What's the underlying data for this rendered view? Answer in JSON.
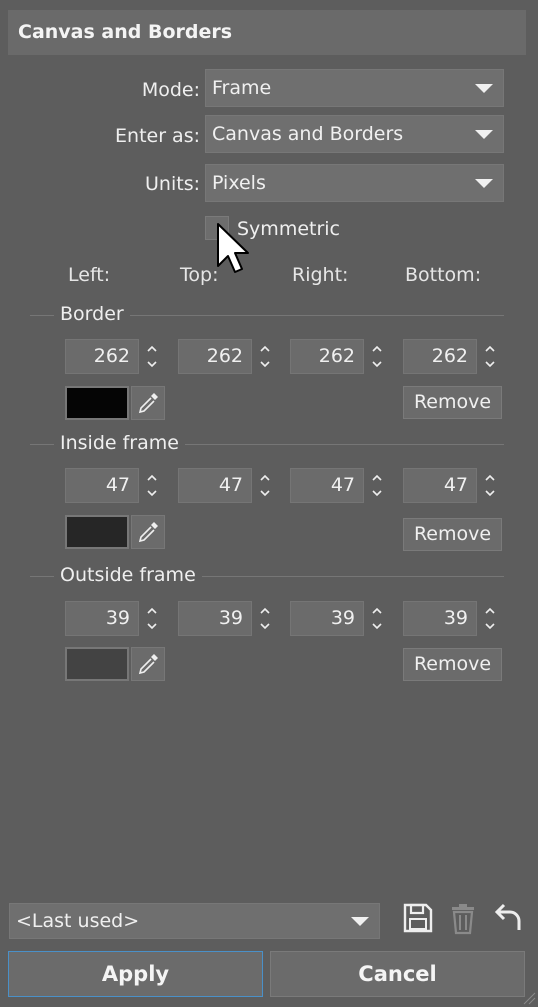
{
  "title": "Canvas and Borders",
  "mode": {
    "label": "Mode:",
    "value": "Frame"
  },
  "enter_as": {
    "label": "Enter as:",
    "value": "Canvas and Borders"
  },
  "units": {
    "label": "Units:",
    "value": "Pixels"
  },
  "symmetric": {
    "label": "Symmetric",
    "checked": false
  },
  "columns": [
    "Left:",
    "Top:",
    "Right:",
    "Bottom:"
  ],
  "groups": [
    {
      "title": "Border",
      "values": [
        "262",
        "262",
        "262",
        "262"
      ],
      "color": "#050505",
      "remove_label": "Remove"
    },
    {
      "title": "Inside frame",
      "values": [
        "47",
        "47",
        "47",
        "47"
      ],
      "color": "#262626",
      "remove_label": "Remove"
    },
    {
      "title": "Outside frame",
      "values": [
        "39",
        "39",
        "39",
        "39"
      ],
      "color": "#434343",
      "remove_label": "Remove"
    }
  ],
  "preset": {
    "value": "<Last used>"
  },
  "buttons": {
    "apply": "Apply",
    "cancel": "Cancel"
  },
  "icons": {
    "save": "save-icon",
    "delete": "trash-icon",
    "reset": "undo-icon",
    "eyedropper": "eyedropper-icon"
  }
}
